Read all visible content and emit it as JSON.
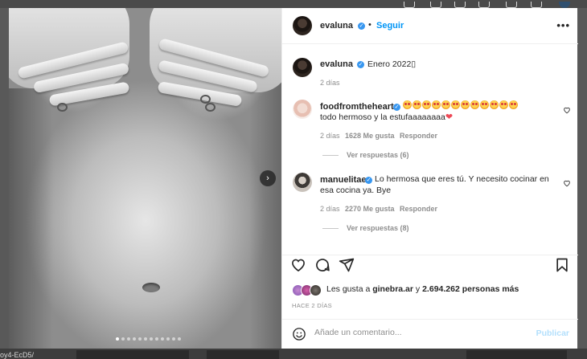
{
  "page": {
    "url_fragment": "oy4-EcD5/"
  },
  "post": {
    "author": "evaluna",
    "follow_label": "Seguir",
    "more_label": "•••",
    "image_alt": "",
    "carousel_next": "›",
    "carousel_dots": 12
  },
  "caption": {
    "author": "evaluna",
    "text": "Enero 2022▯",
    "time": "2 días"
  },
  "comments": [
    {
      "author": "foodfromtheheart",
      "emoji_count": 12,
      "text": "todo hermoso y la estufaaaaaaaa",
      "time": "2 días",
      "likes": "1628 Me gusta",
      "reply": "Responder",
      "view_replies": "Ver respuestas (6)"
    },
    {
      "author": "manuelitae",
      "text": "Lo hermosa que eres tú. Y necesito cocinar en esa cocina ya. Bye",
      "time": "2 días",
      "likes": "2270 Me gusta",
      "reply": "Responder",
      "view_replies": "Ver respuestas (8)"
    }
  ],
  "likes": {
    "prefix": "Les gusta a",
    "first_user": "ginebra.ar",
    "connector": "y",
    "others": "2.694.262 personas más"
  },
  "timestamp": "HACE 2 DÍAS",
  "comment_box": {
    "placeholder": "Añade un comentario...",
    "publish_label": "Publicar"
  },
  "colors": {
    "accent": "#0095f6",
    "verified": "#3897f0",
    "muted": "#8e8e8e",
    "publish_disabled": "#b2dffc",
    "heart": "#ed4956"
  }
}
